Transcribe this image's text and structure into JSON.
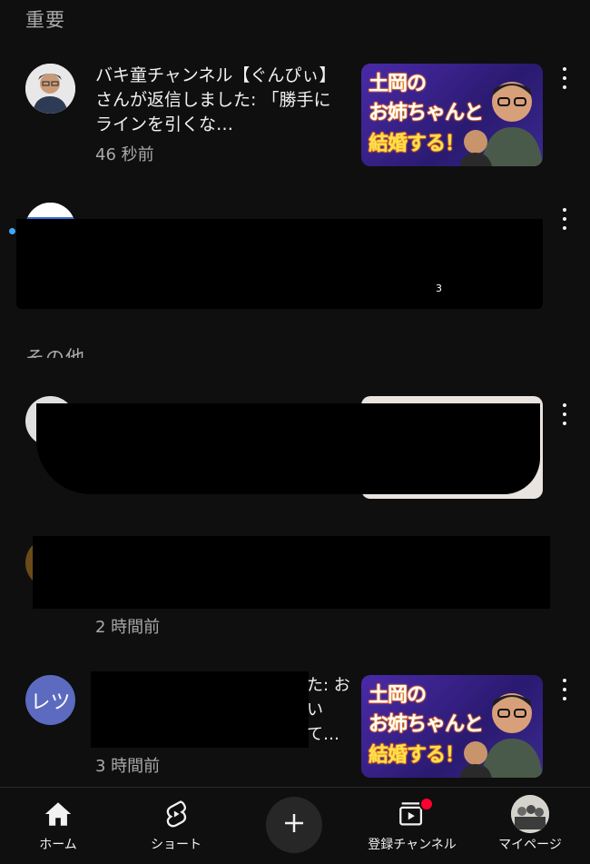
{
  "sections": {
    "important": "重要",
    "other": "その他"
  },
  "notifications": [
    {
      "channel_avatar_text": "",
      "text": "バキ童チャンネル【ぐんぴぃ】さんが返信しました: 「勝手にラインを引くな…",
      "time": "46 秒前",
      "thumb_line1": "土岡の",
      "thumb_line2": "お姉ちゃんと",
      "thumb_line3": "結婚する！"
    },
    {
      "text": "",
      "time": "",
      "thumb_badge": "3"
    },
    {
      "text": "",
      "time": ""
    },
    {
      "text": "",
      "time": "2 時間前"
    },
    {
      "channel_avatar_text": "レツ",
      "text": "た: おい て… 数 がい…",
      "time": "3 時間前",
      "thumb_line1": "土岡の",
      "thumb_line2": "お姉ちゃんと",
      "thumb_line3": "結婚する！"
    }
  ],
  "bottom_nav": {
    "home": "ホーム",
    "shorts": "ショート",
    "subscriptions": "登録チャンネル",
    "mypage": "マイページ"
  },
  "icons": {
    "more": "more-vert-icon",
    "home": "home-icon",
    "shorts": "shorts-icon",
    "create": "plus-icon",
    "subscriptions": "subscriptions-icon"
  },
  "colors": {
    "background": "#0f0f0f",
    "unread": "#3ea6ff",
    "badge": "#ff0033"
  }
}
